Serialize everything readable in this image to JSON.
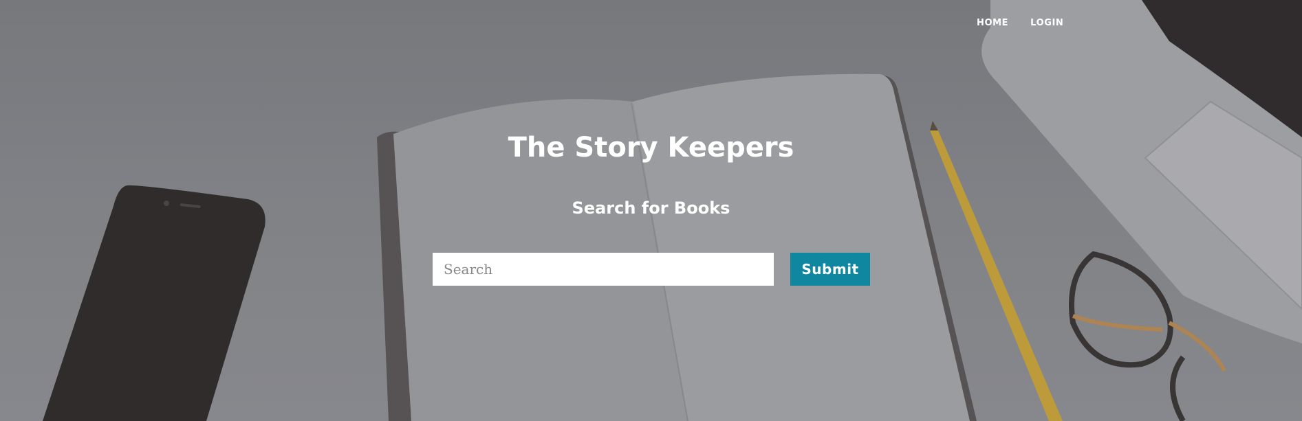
{
  "nav": {
    "home_label": "HOME",
    "login_label": "LOGIN"
  },
  "hero": {
    "title": "The Story Keepers",
    "subtitle": "Search for Books"
  },
  "search": {
    "placeholder": "Search",
    "value": "",
    "submit_label": "Submit"
  },
  "colors": {
    "submit_button": "#0f87a0",
    "text": "#ffffff"
  }
}
